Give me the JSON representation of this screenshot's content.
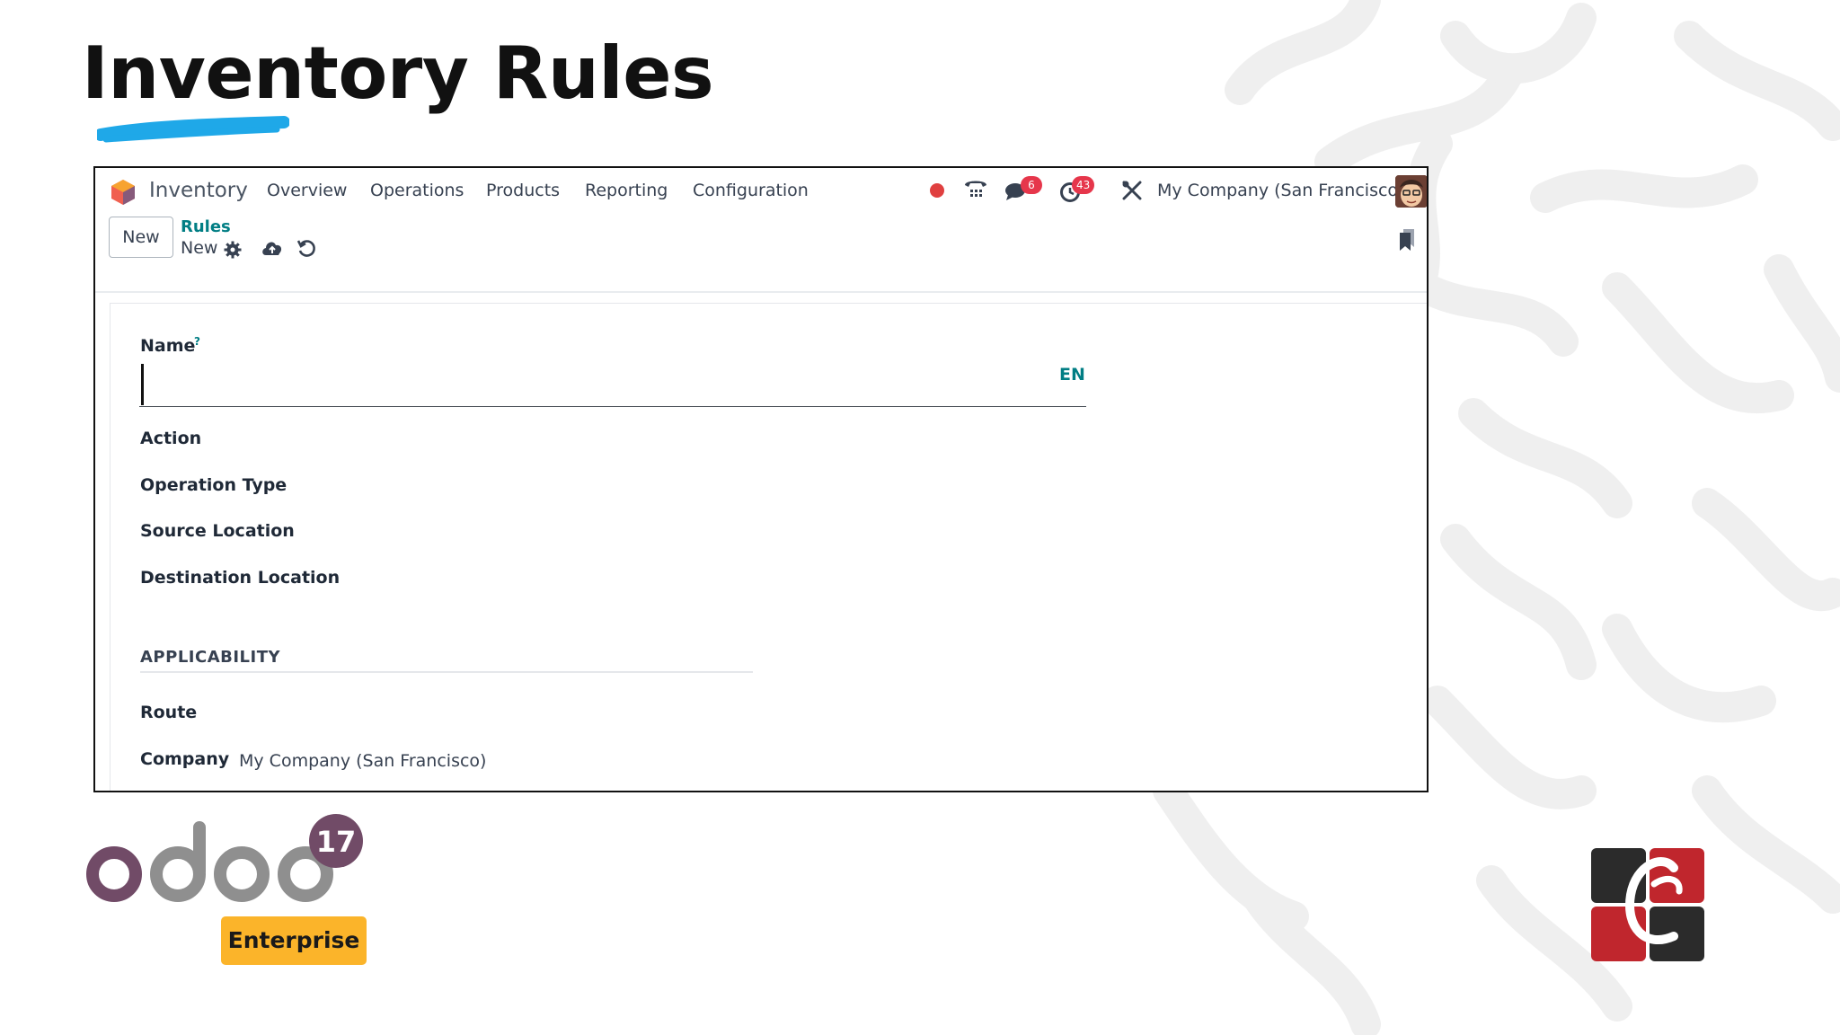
{
  "slide": {
    "title": "Inventory Rules"
  },
  "navbar": {
    "app_name": "Inventory",
    "menu": [
      "Overview",
      "Operations",
      "Products",
      "Reporting",
      "Configuration"
    ],
    "messages_count": "6",
    "activities_count": "43",
    "company": "My Company (San Francisco)"
  },
  "control_panel": {
    "new_label": "New",
    "breadcrumb_parent": "Rules",
    "breadcrumb_current": "New"
  },
  "form": {
    "name_label": "Name",
    "name_help": "?",
    "name_value": "",
    "lang_label": "EN",
    "fields": [
      "Action",
      "Operation Type",
      "Source Location",
      "Destination Location"
    ],
    "section_title": "APPLICABILITY",
    "route_label": "Route",
    "company_label": "Company",
    "company_value": "My Company (San Francisco)"
  },
  "branding": {
    "version": "17",
    "edition": "Enterprise",
    "colors": {
      "odoo_purple": "#714b67",
      "odoo_gray": "#8f8f8f",
      "enterprise": "#fbb42a",
      "accent": "#017e84"
    }
  }
}
